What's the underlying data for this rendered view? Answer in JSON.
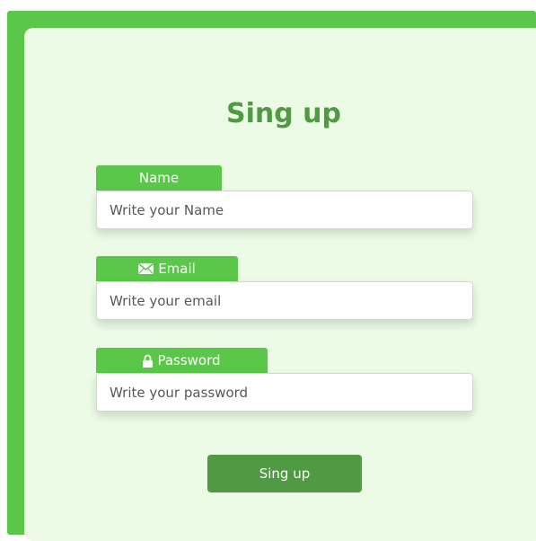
{
  "form": {
    "title": "Sing up",
    "fields": [
      {
        "label": "Name",
        "icon": "",
        "placeholder": "Write your Name",
        "value": ""
      },
      {
        "label": "Email",
        "icon": "envelope-icon",
        "placeholder": "Write your email",
        "value": ""
      },
      {
        "label": "Password",
        "icon": "lock-icon",
        "placeholder": "Write your password",
        "value": ""
      }
    ],
    "submit_label": "Sing up"
  },
  "colors": {
    "accent": "#5bc74a",
    "dark_accent": "#4f9a43",
    "card_background": "#ebfbe6"
  }
}
